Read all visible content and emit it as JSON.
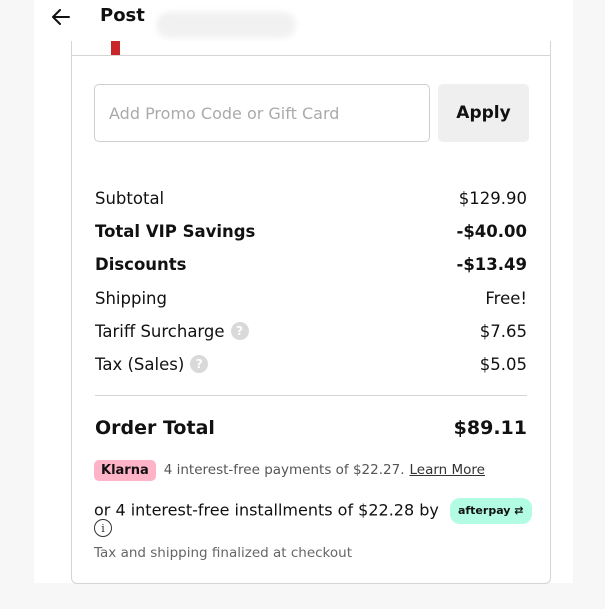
{
  "header": {
    "title": "Post",
    "back_icon": "arrow-left-icon"
  },
  "promo": {
    "placeholder": "Add Promo Code or Gift Card",
    "value": "",
    "apply_label": "Apply"
  },
  "summary": [
    {
      "label": "Subtotal",
      "value": "$129.90",
      "bold": false,
      "help": false
    },
    {
      "label": "Total VIP Savings",
      "value": "-$40.00",
      "bold": true,
      "help": false
    },
    {
      "label": "Discounts",
      "value": "-$13.49",
      "bold": true,
      "help": false
    },
    {
      "label": "Shipping",
      "value": "Free!",
      "bold": false,
      "help": false
    },
    {
      "label": "Tariff Surcharge",
      "value": "$7.65",
      "bold": false,
      "help": true
    },
    {
      "label": "Tax (Sales)",
      "value": "$5.05",
      "bold": false,
      "help": true
    }
  ],
  "total": {
    "label": "Order Total",
    "value": "$89.11"
  },
  "klarna": {
    "badge": "Klarna",
    "text": "4 interest-free payments of $22.27.",
    "link": "Learn More"
  },
  "afterpay": {
    "text": "or 4 interest-free installments of $22.28 by",
    "badge": "afterpay"
  },
  "note": "Tax and shipping finalized at checkout",
  "colors": {
    "klarna_pink": "#ffb3c7",
    "afterpay_mint": "#b2fce4",
    "accent_red": "#c8262a"
  }
}
